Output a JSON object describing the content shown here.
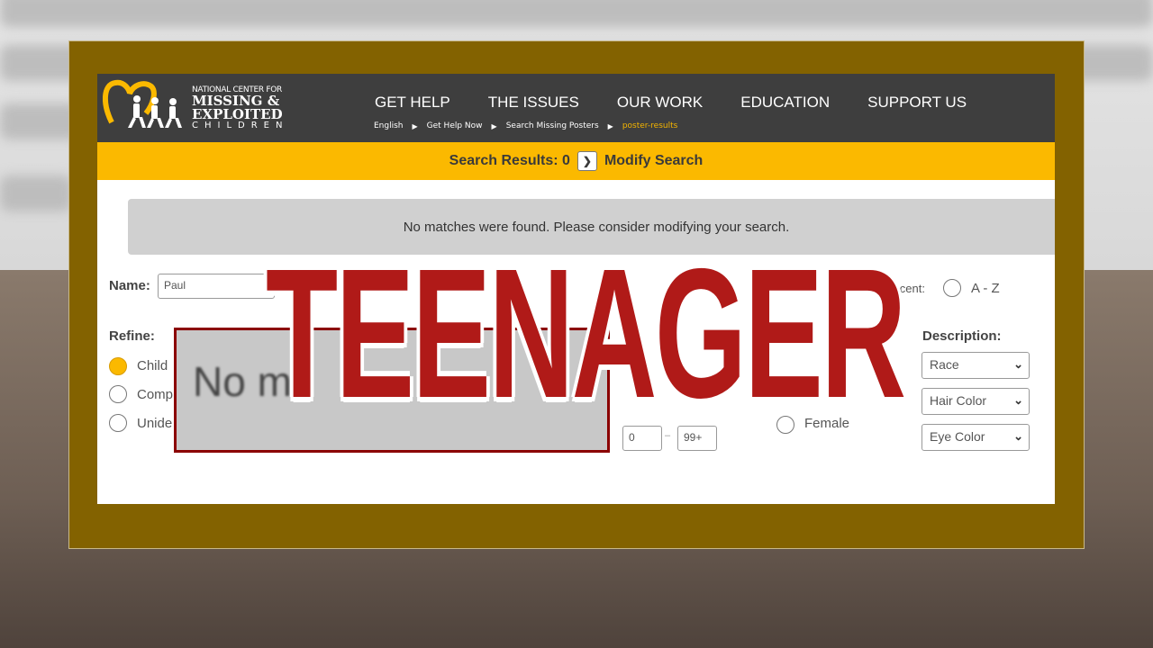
{
  "header": {
    "logo": {
      "line1": "NATIONAL CENTER FOR",
      "line2": "MISSING &",
      "line3": "EXPLOITED",
      "line4": "CHILDREN"
    },
    "nav": [
      "GET HELP",
      "THE ISSUES",
      "OUR WORK",
      "EDUCATION",
      "SUPPORT US"
    ],
    "breadcrumbs": [
      "English",
      "Get Help Now",
      "Search Missing Posters",
      "poster-results"
    ]
  },
  "results_bar": {
    "label": "Search Results: 0",
    "modify": "Modify Search"
  },
  "message": "No matches were found. Please consider modifying your search.",
  "form": {
    "name_label": "Name:",
    "name_value": "Paul",
    "sort_partial": "t recent:",
    "sort_az": "A - Z",
    "refine_label": "Refine:",
    "refine_options": [
      {
        "label": "Child",
        "selected": true
      },
      {
        "label": "Comp",
        "selected": false
      },
      {
        "label": "Unide",
        "selected": false
      }
    ],
    "age_min": "0",
    "age_max": "99+",
    "gender_female": "Female",
    "description_label": "Description:",
    "selects": [
      "Race",
      "Hair Color",
      "Eye Color"
    ]
  },
  "overlay": {
    "zoom_text": "No m",
    "caption": "TEENAGER"
  },
  "colors": {
    "frame": "#836200",
    "header": "#3e3e3e",
    "accent": "#fbb900",
    "caption": "#b01a18"
  }
}
